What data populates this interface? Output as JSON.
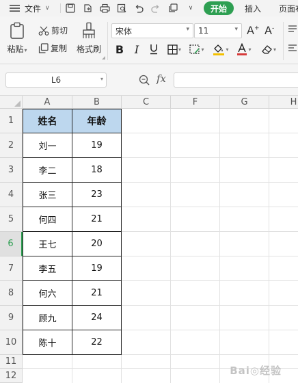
{
  "menubar": {
    "file_label": "文件",
    "tabs": {
      "start": "开始",
      "insert": "插入",
      "layout": "页面布"
    }
  },
  "ribbon": {
    "paste": "粘贴",
    "cut": "剪切",
    "copy": "复制",
    "format_painter": "格式刷",
    "font_name": "宋体",
    "font_size": "11",
    "font_color": "#d63b3b",
    "fill_color": "#f3c000"
  },
  "formula_bar": {
    "name_box": "L6",
    "fx_label": "fx",
    "formula_value": ""
  },
  "sheet": {
    "columns": [
      "A",
      "B",
      "C",
      "F",
      "G",
      "H"
    ],
    "rows": [
      "1",
      "2",
      "3",
      "4",
      "5",
      "6",
      "7",
      "8",
      "9",
      "10",
      "11",
      "12"
    ],
    "active_row": "6",
    "header_fill": "#bdd7ee",
    "table_headers": [
      "姓名",
      "年龄"
    ],
    "table_rows": [
      [
        "刘一",
        "19"
      ],
      [
        "李二",
        "18"
      ],
      [
        "张三",
        "23"
      ],
      [
        "何四",
        "21"
      ],
      [
        "王七",
        "20"
      ],
      [
        "李五",
        "19"
      ],
      [
        "何六",
        "21"
      ],
      [
        "顾九",
        "24"
      ],
      [
        "陈十",
        "22"
      ]
    ]
  }
}
